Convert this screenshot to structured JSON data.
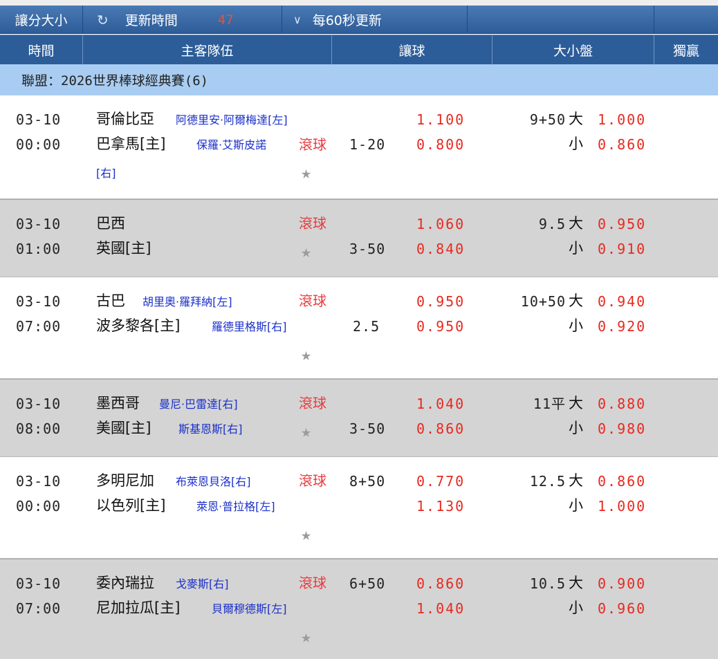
{
  "toolbar": {
    "mode_label": "讓分大小",
    "refresh_icon": "refresh-icon",
    "update_label": "更新時間",
    "countdown": "47",
    "dropdown_icon": "chevron-down-icon",
    "auto_refresh": "每60秒更新"
  },
  "columns": {
    "time": "時間",
    "teams": "主客隊伍",
    "handicap": "讓球",
    "over_under": "大小盤",
    "moneyline": "獨贏"
  },
  "league": "聯盟：2026世界棒球經典賽(6)",
  "labels": {
    "live": "滾球",
    "over": "大",
    "under": "小",
    "star": "★"
  },
  "matches": [
    {
      "date": "03-10",
      "time": "00:00",
      "away": "哥倫比亞",
      "away_pitcher": "阿德里安·阿爾梅達[左]",
      "home": "巴拿馬[主]",
      "home_pitcher_a": "保羅·艾斯皮諾",
      "home_pitcher_b": "[右]",
      "handicap": "1-20",
      "hc_odds_1": "1.100",
      "hc_odds_2": "0.800",
      "ou_line": "9+50",
      "ou_over": "1.000",
      "ou_under": "0.860"
    },
    {
      "date": "03-10",
      "time": "01:00",
      "away": "巴西",
      "home": "英國[主]",
      "handicap": "3-50",
      "hc_odds_1": "1.060",
      "hc_odds_2": "0.840",
      "ou_line": "9.5",
      "ou_over": "0.950",
      "ou_under": "0.910"
    },
    {
      "date": "03-10",
      "time": "07:00",
      "away": "古巴",
      "away_pitcher": "胡里奧·羅拜納[左]",
      "home": "波多黎各[主]",
      "home_pitcher": "羅德里格斯[右]",
      "handicap": "2.5",
      "hc_odds_1": "0.950",
      "hc_odds_2": "0.950",
      "ou_line": "10+50",
      "ou_over": "0.940",
      "ou_under": "0.920"
    },
    {
      "date": "03-10",
      "time": "08:00",
      "away": "墨西哥",
      "away_pitcher": "曼尼·巴雷達[右]",
      "home": "美國[主]",
      "home_pitcher": "斯基恩斯[右]",
      "handicap": "3-50",
      "hc_odds_1": "1.040",
      "hc_odds_2": "0.860",
      "ou_line": "11平",
      "ou_over": "0.880",
      "ou_under": "0.980"
    },
    {
      "date": "03-10",
      "time": "00:00",
      "away": "多明尼加",
      "away_pitcher": "布萊恩貝洛[右]",
      "home": "以色列[主]",
      "home_pitcher": "萊恩·普拉格[左]",
      "handicap": "8+50",
      "hc_odds_1": "0.770",
      "hc_odds_2": "1.130",
      "ou_line": "12.5",
      "ou_over": "0.860",
      "ou_under": "1.000"
    },
    {
      "date": "03-10",
      "time": "07:00",
      "away": "委內瑞拉",
      "away_pitcher": "戈麥斯[右]",
      "home": "尼加拉瓜[主]",
      "home_pitcher": "貝爾穆德斯[左]",
      "handicap": "6+50",
      "hc_odds_1": "0.860",
      "hc_odds_2": "1.040",
      "ou_line": "10.5",
      "ou_over": "0.900",
      "ou_under": "0.960"
    }
  ]
}
